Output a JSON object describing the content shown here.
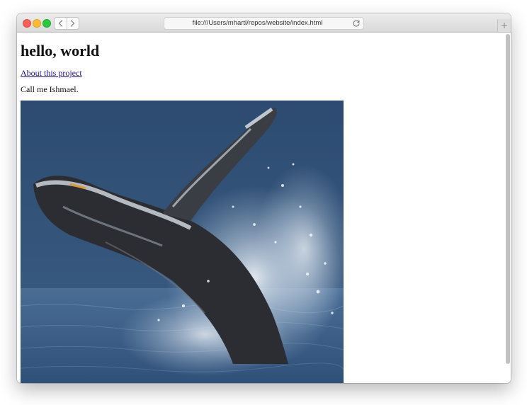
{
  "browser": {
    "address": "file:///Users/mhartl/repos/website/index.html",
    "back_icon": "chevron-left-icon",
    "forward_icon": "chevron-right-icon",
    "reload_icon": "reload-icon",
    "new_tab_icon": "plus-icon",
    "colors": {
      "close": "#fc5f57",
      "minimize": "#fdbc2e",
      "zoom": "#29c941"
    }
  },
  "page": {
    "title": "hello, world",
    "about_link": "About this project",
    "intro_text": "Call me Ishmael.",
    "image_subject": "humpback whale breaching"
  }
}
